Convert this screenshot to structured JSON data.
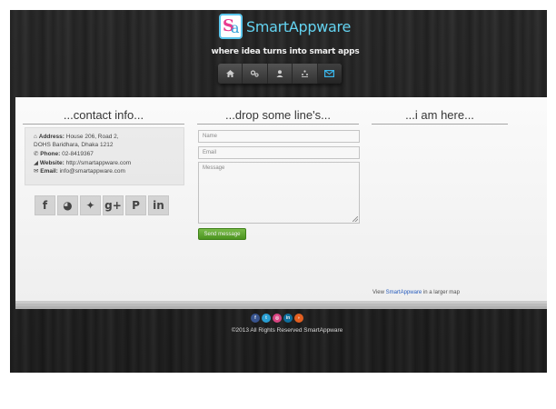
{
  "brand": {
    "name": "SmartAppware",
    "tagline": "where idea turns into smart apps",
    "logo_colors": {
      "cyan": "#5fd3f2",
      "pink": "#e8358c"
    }
  },
  "nav": {
    "items": [
      {
        "icon": "home-icon",
        "glyph": "⌂"
      },
      {
        "icon": "services-icon",
        "glyph": "⚙"
      },
      {
        "icon": "about-icon",
        "glyph": "●"
      },
      {
        "icon": "team-icon",
        "glyph": "⁂"
      },
      {
        "icon": "mail-icon",
        "glyph": "✉"
      }
    ],
    "active_index": 4
  },
  "contact": {
    "title": "...contact info...",
    "address_label": "Address:",
    "address_line1": "House 206, Road 2,",
    "address_line2": "DOHS Baridhara, Dhaka 1212",
    "phone_label": "Phone:",
    "phone": "02-8419367",
    "website_label": "Website:",
    "website": "http://smartappware.com",
    "email_label": "Email:",
    "email": "info@smartappware.com",
    "social": [
      {
        "icon": "facebook-icon",
        "glyph": "f"
      },
      {
        "icon": "github-icon",
        "glyph": "◕"
      },
      {
        "icon": "twitter-icon",
        "glyph": "✦"
      },
      {
        "icon": "google-plus-icon",
        "glyph": "g+"
      },
      {
        "icon": "pinterest-icon",
        "glyph": "P"
      },
      {
        "icon": "linkedin-icon",
        "glyph": "in"
      }
    ]
  },
  "form": {
    "title": "...drop some line's...",
    "name_placeholder": "Name",
    "email_placeholder": "Email",
    "message_placeholder": "Message",
    "send_label": "Send message"
  },
  "map": {
    "title": "...i am here...",
    "link_prefix": "View ",
    "link_text": "SmartAppware",
    "link_suffix": " in a larger map"
  },
  "footer": {
    "icons": [
      {
        "icon": "facebook-icon",
        "glyph": "f",
        "color": "#3b5998"
      },
      {
        "icon": "twitter-icon",
        "glyph": "t",
        "color": "#2ba9e1"
      },
      {
        "icon": "dribbble-icon",
        "glyph": "◎",
        "color": "#e8488a"
      },
      {
        "icon": "linkedin-icon",
        "glyph": "in",
        "color": "#0e76a8"
      },
      {
        "icon": "rss-icon",
        "glyph": "◗",
        "color": "#f26522"
      }
    ],
    "copyright": "©2013 All Rights Reserved SmartAppware"
  }
}
